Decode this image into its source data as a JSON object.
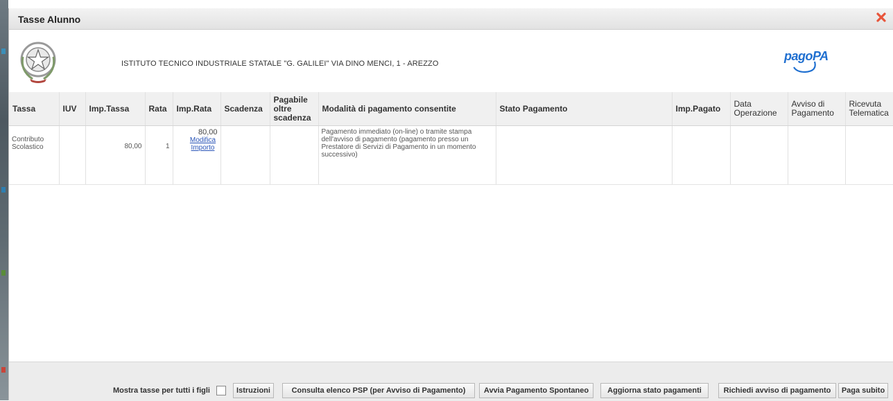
{
  "dialog": {
    "title": "Tasse Alunno"
  },
  "school": {
    "name": "ISTITUTO TECNICO INDUSTRIALE STATALE \"G. GALILEI\" VIA DINO MENCI, 1 - AREZZO"
  },
  "logo": {
    "text": "pagoPA"
  },
  "table": {
    "headers": {
      "tassa": "Tassa",
      "iuv": "IUV",
      "imp_tassa": "Imp.Tassa",
      "rata": "Rata",
      "imp_rata": "Imp.Rata",
      "scadenza": "Scadenza",
      "pagabile_oltre_scadenza": "Pagabile oltre scadenza",
      "modalita": "Modalità di pagamento consentite",
      "stato_pagamento": "Stato Pagamento",
      "imp_pagato": "Imp.Pagato",
      "data_operazione": "Data Operazione",
      "avviso_pagamento": "Avviso di Pagamento",
      "ricevuta_telematica": "Ricevuta Telematica"
    },
    "rows": [
      {
        "tassa": "Contributo Scolastico",
        "iuv": "",
        "imp_tassa": "80,00",
        "rata": "1",
        "imp_rata": "80,00",
        "modifica_link": "Modifica Importo",
        "scadenza": "",
        "pagabile_oltre_scadenza": "",
        "modalita": "Pagamento immediato (on-line) o tramite stampa dell'avviso di pagamento (pagamento presso un Prestatore di Servizi di Pagamento in un momento successivo)",
        "stato_pagamento": "",
        "imp_pagato": "",
        "data_operazione": "",
        "avviso_pagamento": "",
        "ricevuta_telematica": ""
      }
    ]
  },
  "footer": {
    "checkbox_label": "Mostra tasse per tutti i figli",
    "checkbox_checked": false,
    "buttons": {
      "istruzioni": "Istruzioni",
      "consulta_psp": "Consulta elenco PSP (per Avviso di Pagamento)",
      "avvia_spontaneo": "Avvia Pagamento Spontaneo",
      "aggiorna_stato": "Aggiorna stato pagamenti",
      "richiedi_avviso": "Richiedi avviso di pagamento",
      "paga_subito": "Paga subito"
    }
  },
  "icons": {
    "close": "close-icon",
    "emblem": "italian-republic-emblem-icon",
    "pagopa": "pagopa-logo-icon"
  },
  "colors": {
    "close": "#e8553b",
    "link": "#2a55b8",
    "pagopa": "#1f6fd0"
  }
}
